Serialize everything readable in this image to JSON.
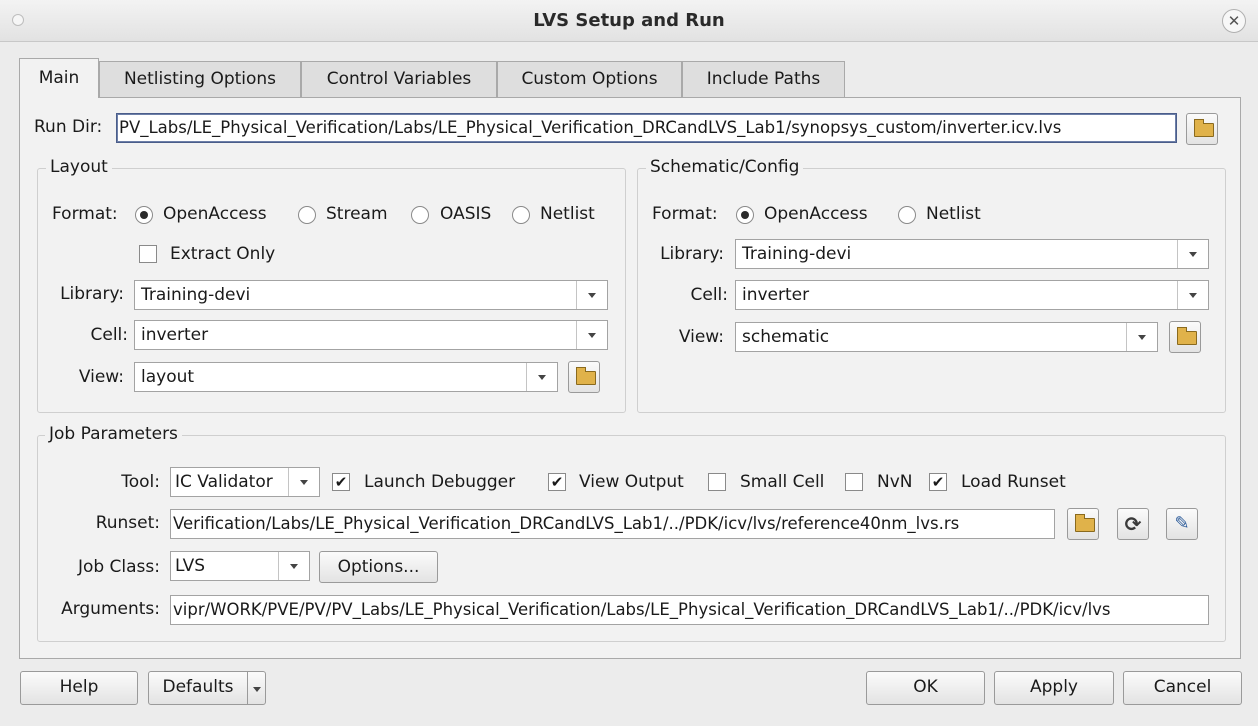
{
  "window": {
    "title": "LVS Setup and Run"
  },
  "tabs": [
    "Main",
    "Netlisting Options",
    "Control Variables",
    "Custom Options",
    "Include Paths"
  ],
  "run_dir": {
    "label": "Run Dir:",
    "value": "PV_Labs/LE_Physical_Verification/Labs/LE_Physical_Verification_DRCandLVS_Lab1/synopsys_custom/inverter.icv.lvs"
  },
  "layout": {
    "title": "Layout",
    "format_label": "Format:",
    "formats": [
      "OpenAccess",
      "Stream",
      "OASIS",
      "Netlist"
    ],
    "format_selected": "OpenAccess",
    "extract_only": "Extract Only",
    "library_label": "Library:",
    "library": "Training-devi",
    "cell_label": "Cell:",
    "cell": "inverter",
    "view_label": "View:",
    "view": "layout"
  },
  "schematic": {
    "title": "Schematic/Config",
    "format_label": "Format:",
    "formats": [
      "OpenAccess",
      "Netlist"
    ],
    "format_selected": "OpenAccess",
    "library_label": "Library:",
    "library": "Training-devi",
    "cell_label": "Cell:",
    "cell": "inverter",
    "view_label": "View:",
    "view": "schematic"
  },
  "job": {
    "title": "Job Parameters",
    "tool_label": "Tool:",
    "tool": "IC Validator",
    "launch_debugger": "Launch Debugger",
    "launch_debugger_checked": true,
    "view_output": "View Output",
    "view_output_checked": true,
    "small_cell": "Small Cell",
    "small_cell_checked": false,
    "nvn": "NvN",
    "nvn_checked": false,
    "load_runset": "Load Runset",
    "load_runset_checked": true,
    "runset_label": "Runset:",
    "runset": "Verification/Labs/LE_Physical_Verification_DRCandLVS_Lab1/../PDK/icv/lvs/reference40nm_lvs.rs",
    "job_class_label": "Job Class:",
    "job_class": "LVS",
    "options": "Options...",
    "arguments_label": "Arguments:",
    "arguments": "vipr/WORK/PVE/PV/PV_Labs/LE_Physical_Verification/Labs/LE_Physical_Verification_DRCandLVS_Lab1/../PDK/icv/lvs"
  },
  "buttons": {
    "help": "Help",
    "defaults": "Defaults",
    "ok": "OK",
    "apply": "Apply",
    "cancel": "Cancel"
  },
  "icons": {
    "folder": "folder-open-icon",
    "refresh": "refresh-icon",
    "edit": "edit-runset-icon",
    "close": "close-icon",
    "dropdown": "chevron-down-icon"
  }
}
